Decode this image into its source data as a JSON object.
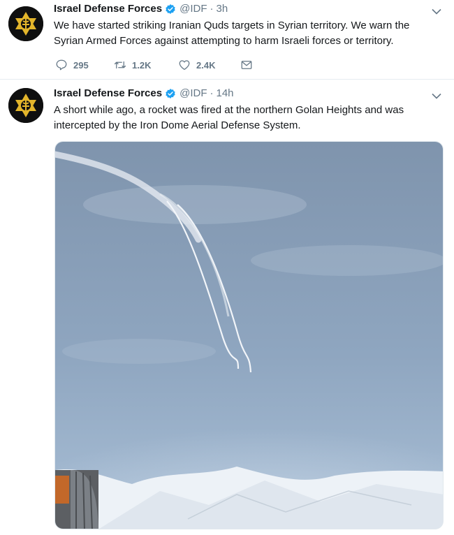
{
  "tweets": [
    {
      "display_name": "Israel Defense Forces",
      "handle": "@IDF",
      "separator": "·",
      "time": "3h",
      "text": "We have started striking Iranian Quds targets in Syrian territory. We warn the Syrian Armed Forces against attempting to harm Israeli forces or territory.",
      "replies": "295",
      "retweets": "1.2K",
      "likes": "2.4K"
    },
    {
      "display_name": "Israel Defense Forces",
      "handle": "@IDF",
      "separator": "·",
      "time": "14h",
      "text": "A short while ago, a rocket was fired at the northern Golan Heights and was intercepted by the Iron Dome Aerial Defense System."
    }
  ],
  "colors": {
    "text_primary": "#14171a",
    "text_secondary": "#657786",
    "verified_blue": "#1da1f2",
    "avatar_bg": "#0f0f0f",
    "logo_gold": "#e3b52b",
    "divider": "#e6ecf0"
  },
  "icons": [
    "idf-logo-icon",
    "verified-badge-icon",
    "chevron-down-icon",
    "reply-icon",
    "retweet-icon",
    "like-icon",
    "direct-message-icon"
  ]
}
